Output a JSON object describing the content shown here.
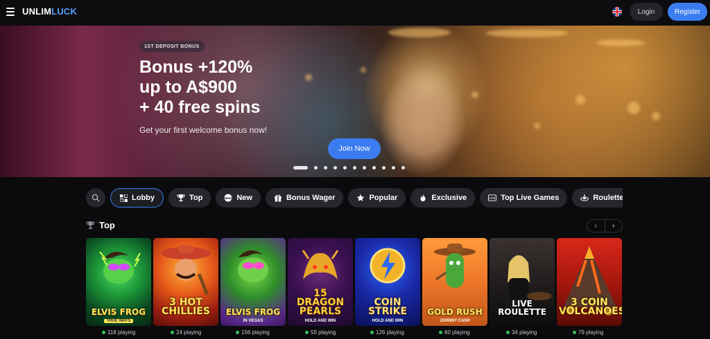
{
  "header": {
    "logo_part1": "UNLIM",
    "logo_part2": "LUCK",
    "login": "Login",
    "register": "Register"
  },
  "hero": {
    "badge": "1ST DEPOSIT BONUS",
    "title_line1": "Bonus +120%",
    "title_line2": "up to A$900",
    "title_line3": "+ 40 free spins",
    "subtitle": "Get your first welcome bonus now!",
    "cta": "Join Now",
    "slides_count": 11,
    "active_slide": 1
  },
  "categories": [
    {
      "label": "Lobby",
      "icon": "lobby-icon",
      "active": true
    },
    {
      "label": "Top",
      "icon": "trophy-icon",
      "active": false
    },
    {
      "label": "New",
      "icon": "new-badge-icon",
      "active": false
    },
    {
      "label": "Bonus Wager",
      "icon": "gift-icon",
      "active": false
    },
    {
      "label": "Popular",
      "icon": "star-icon",
      "active": false
    },
    {
      "label": "Exclusive",
      "icon": "flame-icon",
      "active": false
    },
    {
      "label": "Top Live Games",
      "icon": "live-icon",
      "active": false
    },
    {
      "label": "Roulette",
      "icon": "roulette-icon",
      "active": false
    }
  ],
  "section": {
    "title": "Top",
    "prev": "‹",
    "next": "›"
  },
  "games": [
    {
      "name": "ELVIS FROG",
      "sub": "TRUE WAYS",
      "playing": "118 playing"
    },
    {
      "name": "3 HOT CHILLIES",
      "sub": "",
      "playing": "24 playing"
    },
    {
      "name": "ELVIS FROG",
      "sub": "IN VEGAS",
      "playing": "156 playing"
    },
    {
      "name": "15 DRAGON PEARLS",
      "sub": "HOLD AND WIN",
      "playing": "55 playing"
    },
    {
      "name": "COIN STRIKE",
      "sub": "HOLD AND WIN",
      "playing": "126 playing"
    },
    {
      "name": "GOLD RUSH",
      "sub": "JOHNNY CASH",
      "playing": "60 playing"
    },
    {
      "name": "LIVE ROULETTE",
      "sub": "",
      "playing": "34 playing"
    },
    {
      "name": "3 COIN VOLCANOES",
      "sub": "",
      "playing": "79 playing"
    }
  ],
  "colors": {
    "accent": "#3b7cf0",
    "background": "#0b0b0d",
    "chip": "#25272d",
    "online": "#36c35c"
  }
}
